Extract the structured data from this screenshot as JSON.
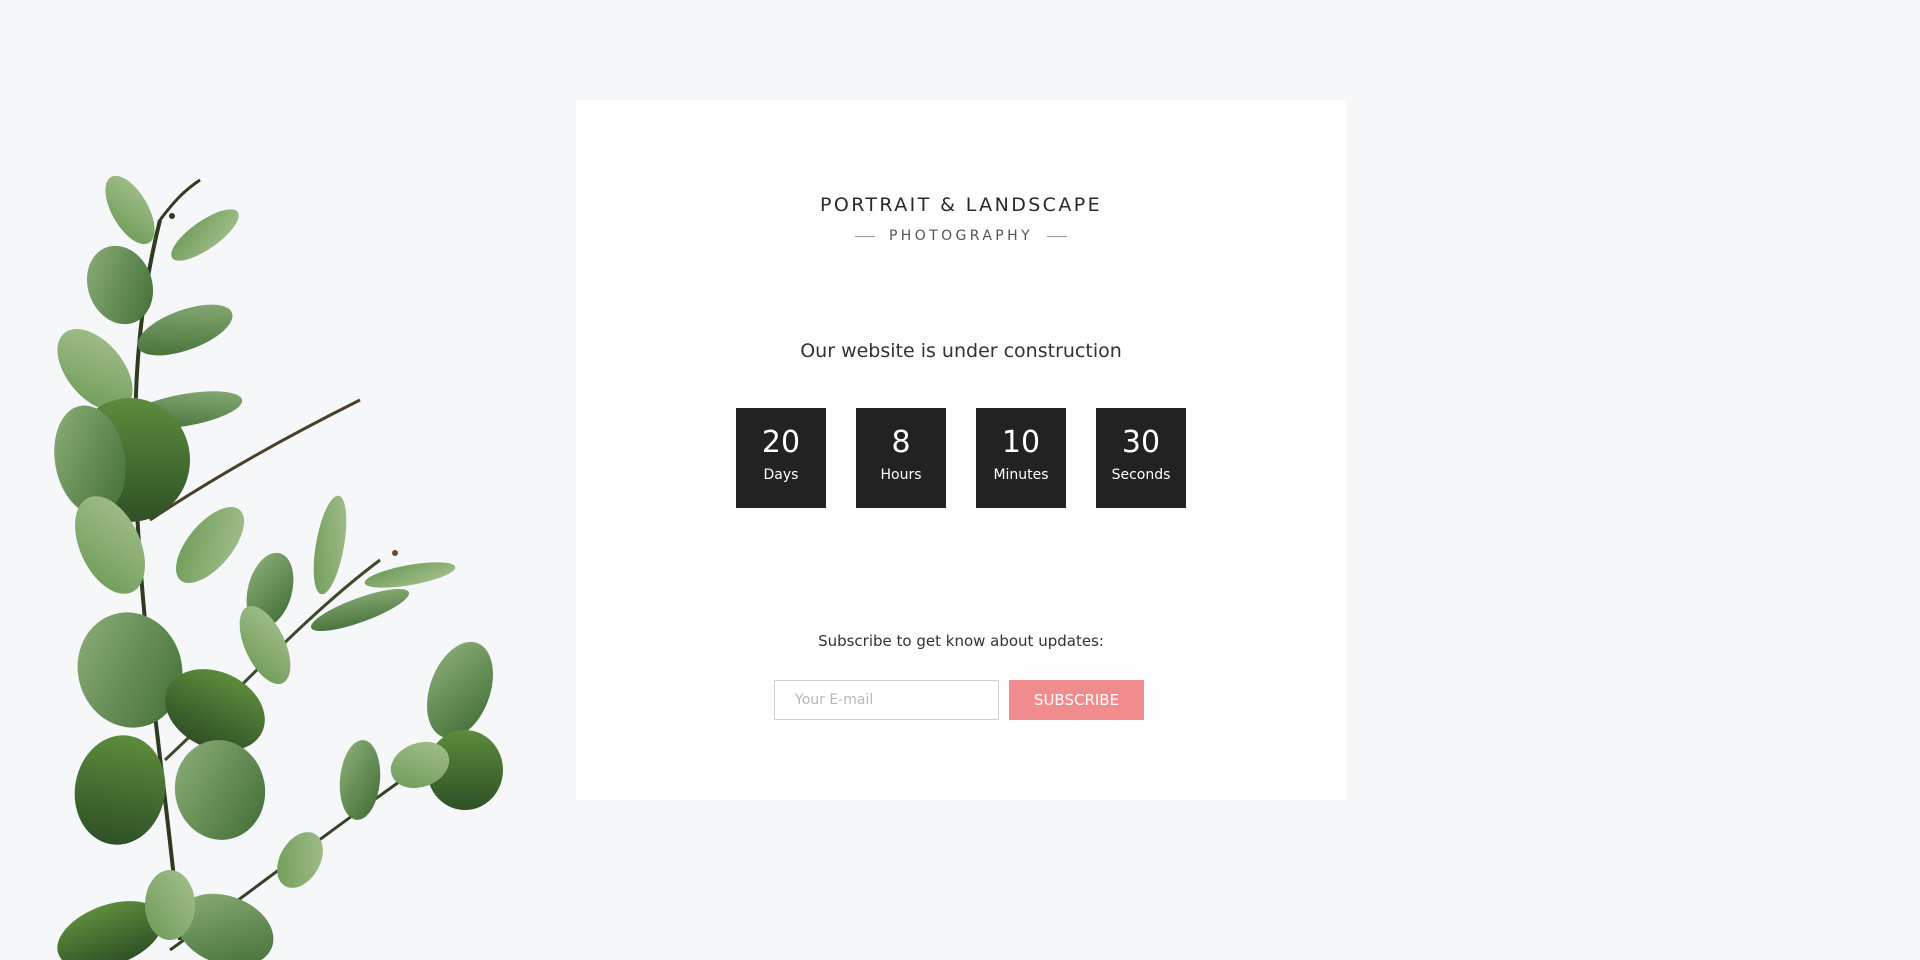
{
  "brand": {
    "title": "PORTRAIT & LANDSCAPE",
    "subtitle": "PHOTOGRAPHY"
  },
  "headline": "Our website is under construction",
  "countdown": [
    {
      "value": "20",
      "label": "Days"
    },
    {
      "value": "8",
      "label": "Hours"
    },
    {
      "value": "10",
      "label": "Minutes"
    },
    {
      "value": "30",
      "label": "Seconds"
    }
  ],
  "subscribe": {
    "prompt": "Subscribe to get know about updates:",
    "email_placeholder": "Your E-mail",
    "email_value": "",
    "button_label": "SUBSCRIBE"
  },
  "colors": {
    "page_background": "#f6f7f8",
    "card_background": "#fdfdfe",
    "countdown_box": "#222222",
    "accent_button": "#f08c8e",
    "leaf_green": "#5b8a4a"
  },
  "decor": {
    "plant_icon": "eucalyptus-branch-icon"
  }
}
